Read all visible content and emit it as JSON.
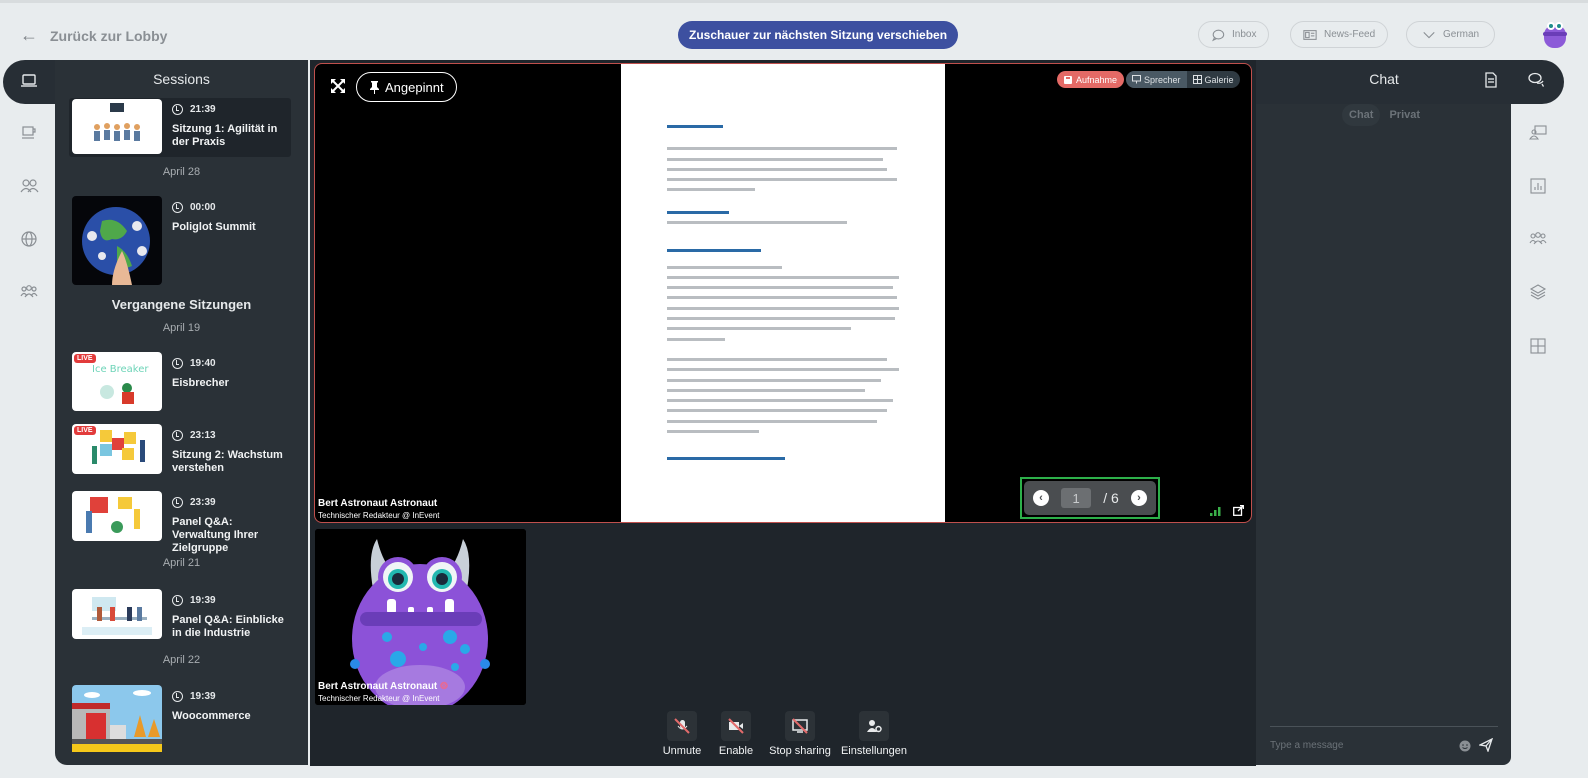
{
  "topbar": {
    "back_label": "Zurück zur Lobby",
    "move_button": "Zuschauer zur nächsten Sitzung verschieben",
    "inbox": "Inbox",
    "news_feed": "News-Feed",
    "language": "German"
  },
  "sessions": {
    "title": "Sessions",
    "upcoming": [
      {
        "time": "21:39",
        "title": "Sitzung 1: Agilität in der Praxis",
        "live": false,
        "active": true
      },
      {
        "date": "April 28"
      },
      {
        "time": "00:00",
        "title": "Poliglot Summit",
        "live": false
      }
    ],
    "past_title": "Vergangene Sitzungen",
    "past": [
      {
        "date": "April 19"
      },
      {
        "time": "19:40",
        "title": "Eisbrecher",
        "live": true,
        "badge": "LIVE"
      },
      {
        "time": "23:13",
        "title": "Sitzung 2: Wachstum verstehen",
        "live": true,
        "badge": "LIVE"
      },
      {
        "time": "23:39",
        "title": "Panel Q&A: Verwaltung Ihrer Zielgruppe",
        "live": false
      },
      {
        "date": "April 21"
      },
      {
        "time": "19:39",
        "title": "Panel Q&A: Einblicke in die Industrie",
        "live": false
      },
      {
        "date": "April 22"
      },
      {
        "time": "19:39",
        "title": "Woocommerce",
        "live": false
      }
    ]
  },
  "stage": {
    "pinned_label": "Angepinnt",
    "recording_label": "Aufnahme",
    "view_speaker": "Sprecher",
    "view_gallery": "Galerie",
    "pager": {
      "current": "1",
      "total_label": "/ 6"
    },
    "presenter": {
      "name": "Bert Astronaut Astronaut",
      "role": "Technischer Redakteur @ InEvent"
    },
    "thumbnail": {
      "name": "Bert Astronaut Astronaut",
      "role": "Technischer Redakteur @ InEvent"
    }
  },
  "controls": {
    "unmute": "Unmute",
    "enable": "Enable",
    "stop_sharing": "Stop sharing",
    "settings": "Einstellungen"
  },
  "chat": {
    "title": "Chat",
    "tab_chat": "Chat",
    "tab_private": "Privat",
    "input_placeholder": "Type a message"
  },
  "colors": {
    "primary": "#3d50a0",
    "panel": "#2a3137",
    "record": "#e46a66",
    "pager_border": "#2db04a",
    "active_border": "#c0504d"
  }
}
